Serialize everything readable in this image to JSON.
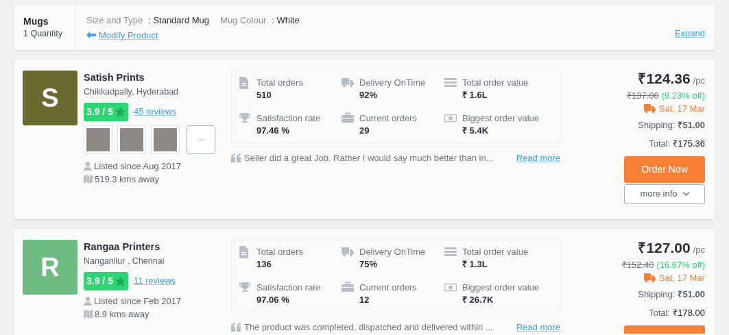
{
  "product": {
    "name": "Mugs",
    "quantity": "1 Quantity",
    "options": [
      {
        "label": "Size and Type",
        "value": ": Standard Mug"
      },
      {
        "label": "Mug Colour",
        "value": ": White"
      }
    ],
    "modify_link": "Modify Product",
    "expand_link": "Expand"
  },
  "sellers": [
    {
      "initial": "S",
      "color": "#6b6a2e",
      "name": "Satish Prints",
      "location": "Chikkadpally, Hyderabad",
      "rating": "3.9 / 5",
      "reviews": "45 reviews",
      "thumbnails": [
        {
          "kind": "photo"
        },
        {
          "kind": "photo"
        },
        {
          "kind": "photo"
        }
      ],
      "more_thumbs": "···",
      "listed": "Listed since Aug 2017",
      "distance": "519.3 kms away",
      "stats": [
        {
          "kind": "orders",
          "label": "Total orders",
          "value": "510"
        },
        {
          "kind": "delivery",
          "label": "Delivery OnTime",
          "value": "92%"
        },
        {
          "kind": "value",
          "label": "Total order value",
          "value": "₹ 1.6L"
        },
        {
          "kind": "satisfaction",
          "label": "Satisfaction rate",
          "value": "97.46 %"
        },
        {
          "kind": "current",
          "label": "Current orders",
          "value": "29"
        },
        {
          "kind": "biggest",
          "label": "Biggest order value",
          "value": "₹ 5.4K"
        }
      ],
      "review": "Seller did a great Job. Rather I would say much better than in...",
      "read_more": "Read more",
      "price": "₹124.36",
      "unit": "/pc",
      "old_price": "₹137.00",
      "discount": "(9.23% off)",
      "delivery": "Sat, 17 Mar",
      "shipping_label": "Shipping:",
      "shipping": "₹51.00",
      "total_label": "Total:",
      "total": "₹175.36",
      "order_button": "Order Now",
      "more_info": "more info"
    },
    {
      "initial": "R",
      "color": "#6dbb80",
      "name": "Rangaa Printers",
      "location": "Nanganllur , Chennai",
      "rating": "3.9 / 5",
      "reviews": "11 reviews",
      "listed": "Listed since Feb 2017",
      "distance": "8.9 kms away",
      "stats": [
        {
          "kind": "orders",
          "label": "Total orders",
          "value": "136"
        },
        {
          "kind": "delivery",
          "label": "Delivery OnTime",
          "value": "75%"
        },
        {
          "kind": "value",
          "label": "Total order value",
          "value": "₹ 1.3L"
        },
        {
          "kind": "satisfaction",
          "label": "Satisfaction rate",
          "value": "97.06 %"
        },
        {
          "kind": "current",
          "label": "Current orders",
          "value": "12"
        },
        {
          "kind": "biggest",
          "label": "Biggest order value",
          "value": "₹ 26.7K"
        }
      ],
      "review": "The product was completed, dispatched and delivered within ...",
      "read_more": "Read more",
      "price": "₹127.00",
      "unit": "/pc",
      "old_price": "₹152.40",
      "discount": "(16.67% off)",
      "delivery": "Sat, 17 Mar",
      "shipping_label": "Shipping:",
      "shipping": "₹51.00",
      "total_label": "Total:",
      "total": "₹178.00",
      "order_button_cut": true
    }
  ]
}
